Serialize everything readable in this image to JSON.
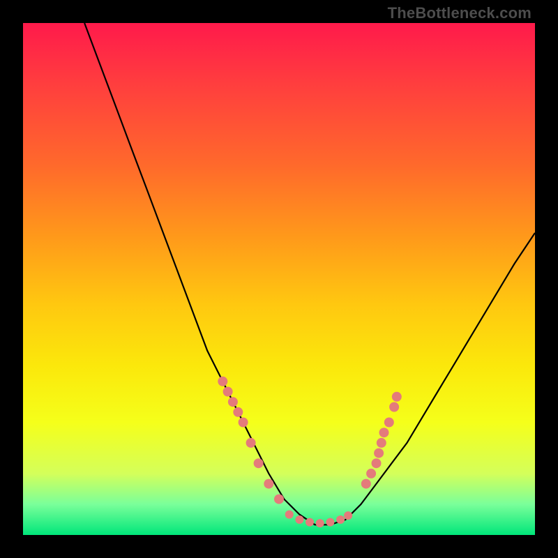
{
  "watermark": "TheBottleneck.com",
  "chart_data": {
    "type": "line",
    "title": "",
    "xlabel": "",
    "ylabel": "",
    "xlim": [
      0,
      100
    ],
    "ylim": [
      0,
      100
    ],
    "series": [
      {
        "name": "curve",
        "x": [
          12,
          15,
          18,
          21,
          24,
          27,
          30,
          33,
          36,
          39,
          42,
          45,
          48,
          51,
          54,
          57,
          60,
          63,
          66,
          69,
          72,
          75,
          78,
          81,
          84,
          87,
          90,
          93,
          96,
          100
        ],
        "y": [
          100,
          92,
          84,
          76,
          68,
          60,
          52,
          44,
          36,
          30,
          24,
          18,
          12,
          7,
          4,
          2,
          2,
          3,
          6,
          10,
          14,
          18,
          23,
          28,
          33,
          38,
          43,
          48,
          53,
          59
        ]
      }
    ],
    "markers_left": [
      {
        "x": 39,
        "y": 30
      },
      {
        "x": 40,
        "y": 28
      },
      {
        "x": 41,
        "y": 26
      },
      {
        "x": 42,
        "y": 24
      },
      {
        "x": 43,
        "y": 22
      },
      {
        "x": 44.5,
        "y": 18
      },
      {
        "x": 46,
        "y": 14
      },
      {
        "x": 48,
        "y": 10
      },
      {
        "x": 50,
        "y": 7
      }
    ],
    "markers_bottom": [
      {
        "x": 52,
        "y": 4
      },
      {
        "x": 54,
        "y": 3
      },
      {
        "x": 56,
        "y": 2.5
      },
      {
        "x": 58,
        "y": 2.3
      },
      {
        "x": 60,
        "y": 2.5
      },
      {
        "x": 62,
        "y": 3
      },
      {
        "x": 63.5,
        "y": 3.8
      }
    ],
    "markers_right": [
      {
        "x": 67,
        "y": 10
      },
      {
        "x": 68,
        "y": 12
      },
      {
        "x": 69,
        "y": 14
      },
      {
        "x": 69.5,
        "y": 16
      },
      {
        "x": 70,
        "y": 18
      },
      {
        "x": 70.5,
        "y": 20
      },
      {
        "x": 71.5,
        "y": 22
      },
      {
        "x": 72.5,
        "y": 25
      },
      {
        "x": 73,
        "y": 27
      }
    ]
  }
}
